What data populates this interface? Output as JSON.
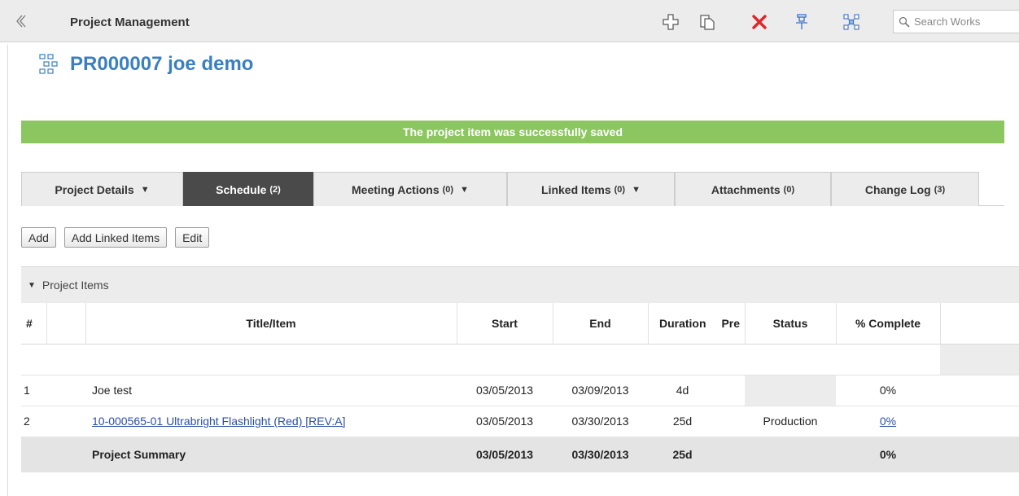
{
  "app": {
    "title": "Project Management",
    "search_placeholder": "Search Works"
  },
  "page": {
    "title": "PR000007 joe demo"
  },
  "banner": {
    "message": "The project item was successfully saved",
    "color": "#8cc660"
  },
  "tabs": [
    {
      "label": "Project Details",
      "count": "",
      "dropdown": true,
      "active": false
    },
    {
      "label": "Schedule",
      "count": "(2)",
      "dropdown": false,
      "active": true
    },
    {
      "label": "Meeting Actions",
      "count": "(0)",
      "dropdown": true,
      "active": false
    },
    {
      "label": "Linked Items",
      "count": "(0)",
      "dropdown": true,
      "active": false
    },
    {
      "label": "Attachments",
      "count": "(0)",
      "dropdown": false,
      "active": false
    },
    {
      "label": "Change Log",
      "count": "(3)",
      "dropdown": false,
      "active": false
    }
  ],
  "actions": {
    "add_label": "Add",
    "add_linked_label": "Add Linked Items",
    "edit_label": "Edit"
  },
  "panel": {
    "title": "Project Items",
    "columns": {
      "num": "#",
      "title": "Title/Item",
      "start": "Start",
      "end": "End",
      "duration": "Duration",
      "pre": "Pre",
      "status": "Status",
      "complete": "% Complete"
    },
    "rows": [
      {
        "num": "1",
        "title": "Joe test",
        "link": false,
        "start": "03/05/2013",
        "end": "03/09/2013",
        "duration": "4d",
        "pre": "",
        "status": "",
        "complete": "0%",
        "complete_link": false
      },
      {
        "num": "2",
        "title": "10-000565-01 Ultrabright Flashlight (Red) [REV:A]",
        "link": true,
        "start": "03/05/2013",
        "end": "03/30/2013",
        "duration": "25d",
        "pre": "",
        "status": "Production",
        "complete": "0%",
        "complete_link": true
      }
    ],
    "summary": {
      "title": "Project Summary",
      "start": "03/05/2013",
      "end": "03/30/2013",
      "duration": "25d",
      "complete": "0%"
    }
  },
  "icons": {
    "back": "chevron-left-icon",
    "add": "plus-icon",
    "copy": "copy-icon",
    "delete": "delete-x-icon",
    "pin": "pin-icon",
    "network": "network-icon",
    "search": "search-icon",
    "project": "project-tree-icon"
  },
  "colors": {
    "accent": "#3a7fc1",
    "delete": "#e0262b",
    "link": "#2a4ea8",
    "tab_active": "#4a4a4a"
  }
}
